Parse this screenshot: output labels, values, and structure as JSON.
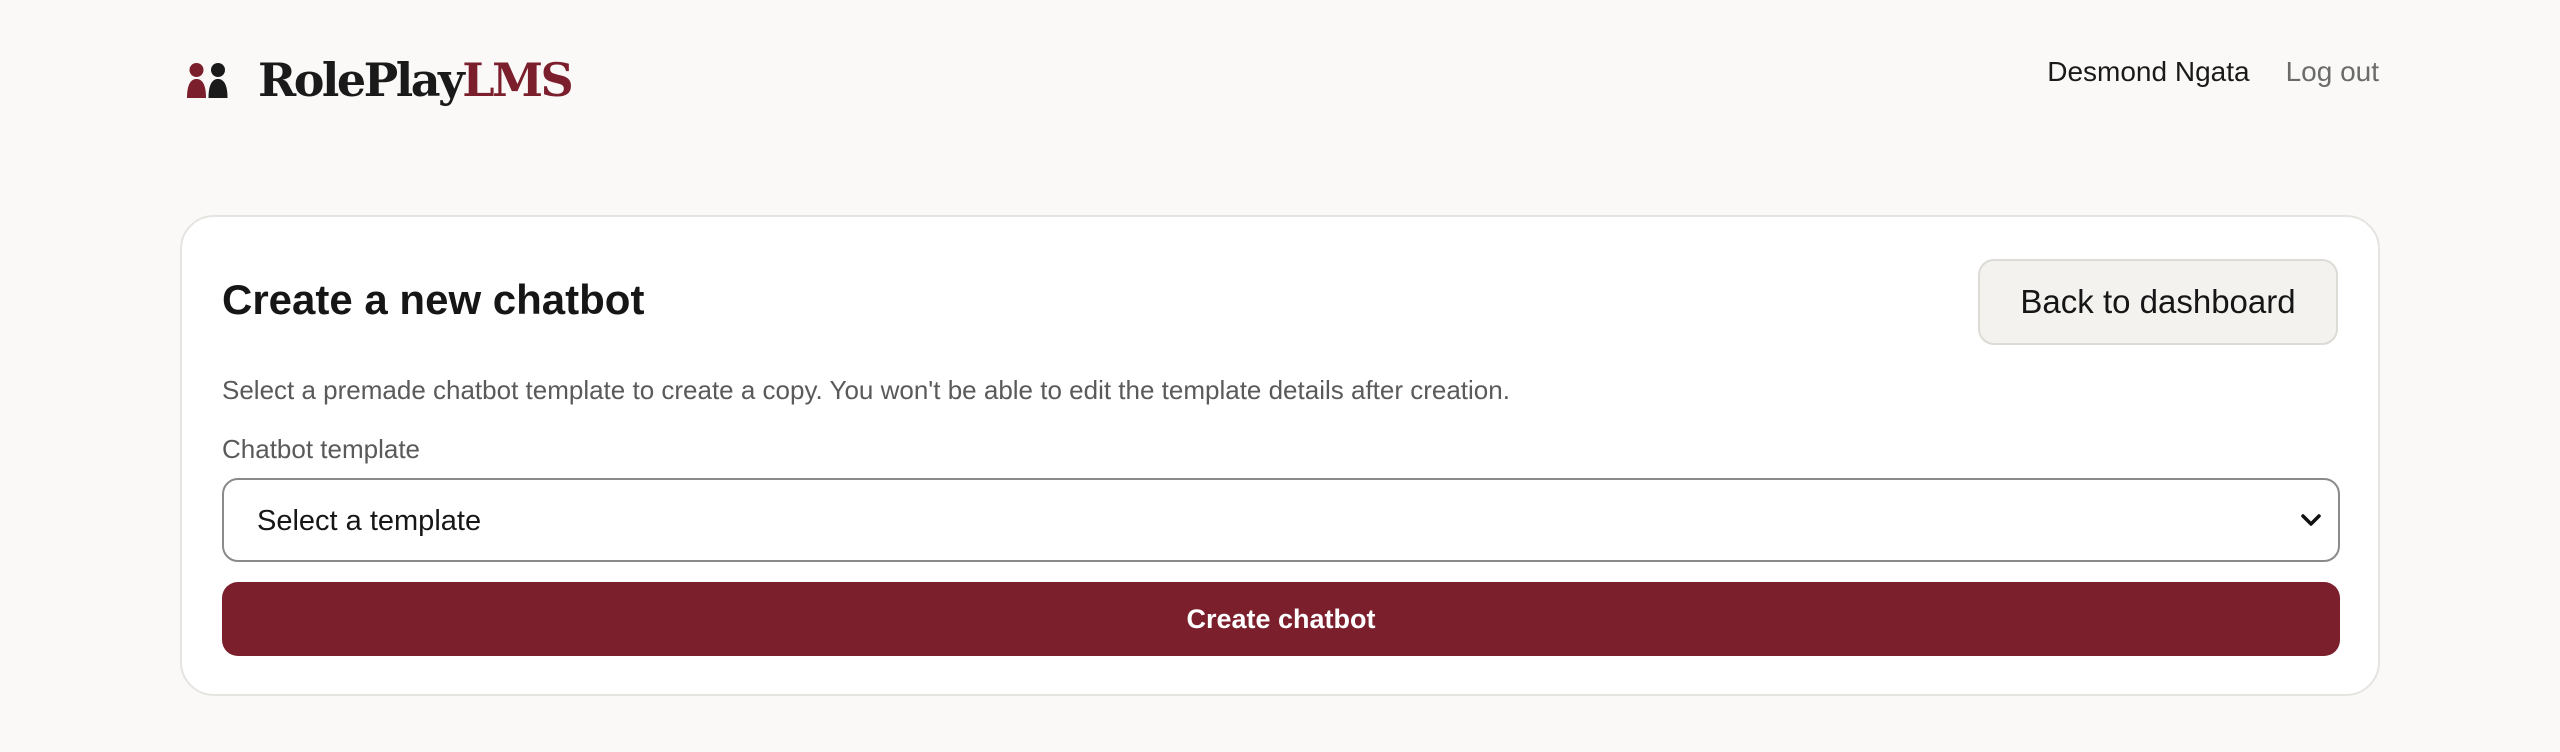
{
  "brand": {
    "name_part1": "RolePlay",
    "name_part2": "LMS",
    "accent_color": "#7b1f2c",
    "icon": "two-people-icon"
  },
  "user_nav": {
    "user_name": "Desmond Ngata",
    "logout_label": "Log out"
  },
  "card": {
    "title": "Create a new chatbot",
    "back_button_label": "Back to dashboard",
    "description": "Select a premade chatbot template to create a copy. You won't be able to edit the template details after creation.",
    "template_field": {
      "label": "Chatbot template",
      "selected_value": "Select a template",
      "icon": "chevron-down-icon"
    },
    "submit_label": "Create chatbot"
  }
}
